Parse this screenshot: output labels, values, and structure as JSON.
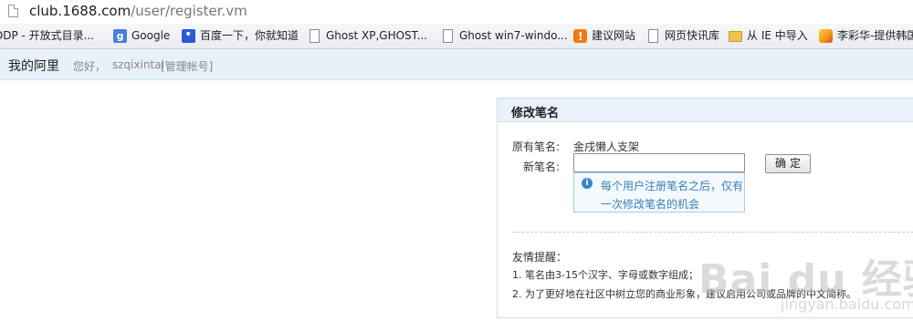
{
  "browser": {
    "url_host": "club.1688.com",
    "url_path": "/user/register.vm"
  },
  "bookmarks": [
    {
      "label": "DDP - 开放式目录...",
      "icon": "none"
    },
    {
      "label": "Google",
      "icon": "google-icon"
    },
    {
      "label": "百度一下，你就知道",
      "icon": "baidu-paw-icon"
    },
    {
      "label": "Ghost XP,GHOST...",
      "icon": "page-icon"
    },
    {
      "label": "Ghost win7-windo...",
      "icon": "page-icon"
    },
    {
      "label": "建议网站",
      "icon": "lightbulb-icon"
    },
    {
      "label": "网页快讯库",
      "icon": "page-icon"
    },
    {
      "label": "从 IE 中导入",
      "icon": "folder-icon"
    },
    {
      "label": "李彩华-提供韩国",
      "icon": "person-icon"
    }
  ],
  "topbar": {
    "brand": "我的阿里",
    "greeting": "您好，",
    "username": "szqixintai",
    "manage": "[管理帐号]"
  },
  "panel": {
    "title": "修改笔名",
    "original_label": "原有笔名:",
    "original_value": "金戌懒人支架",
    "new_label": "新笔名:",
    "new_value": "",
    "ok_button": "确定",
    "tip_line1": "每个用户注册笔名之后，仅有",
    "tip_line2": "一次修改笔名的机会",
    "reminder_title": "友情提醒：",
    "reminder_1": "1. 笔名由3-15个汉字、字母或数字组成；",
    "reminder_2": "2. 为了更好地在社区中树立您的商业形象，建议启用公司或品牌的中文简称。"
  },
  "watermark": {
    "main": "Bai du 经验",
    "sub": "jingyan.baidu.com"
  },
  "colors": {
    "topbar_bg": "#e8f0fa",
    "panel_head_bg": "#e9f1fb",
    "tip_text": "#3a7fb8",
    "tip_icon": "#3a86c4"
  }
}
